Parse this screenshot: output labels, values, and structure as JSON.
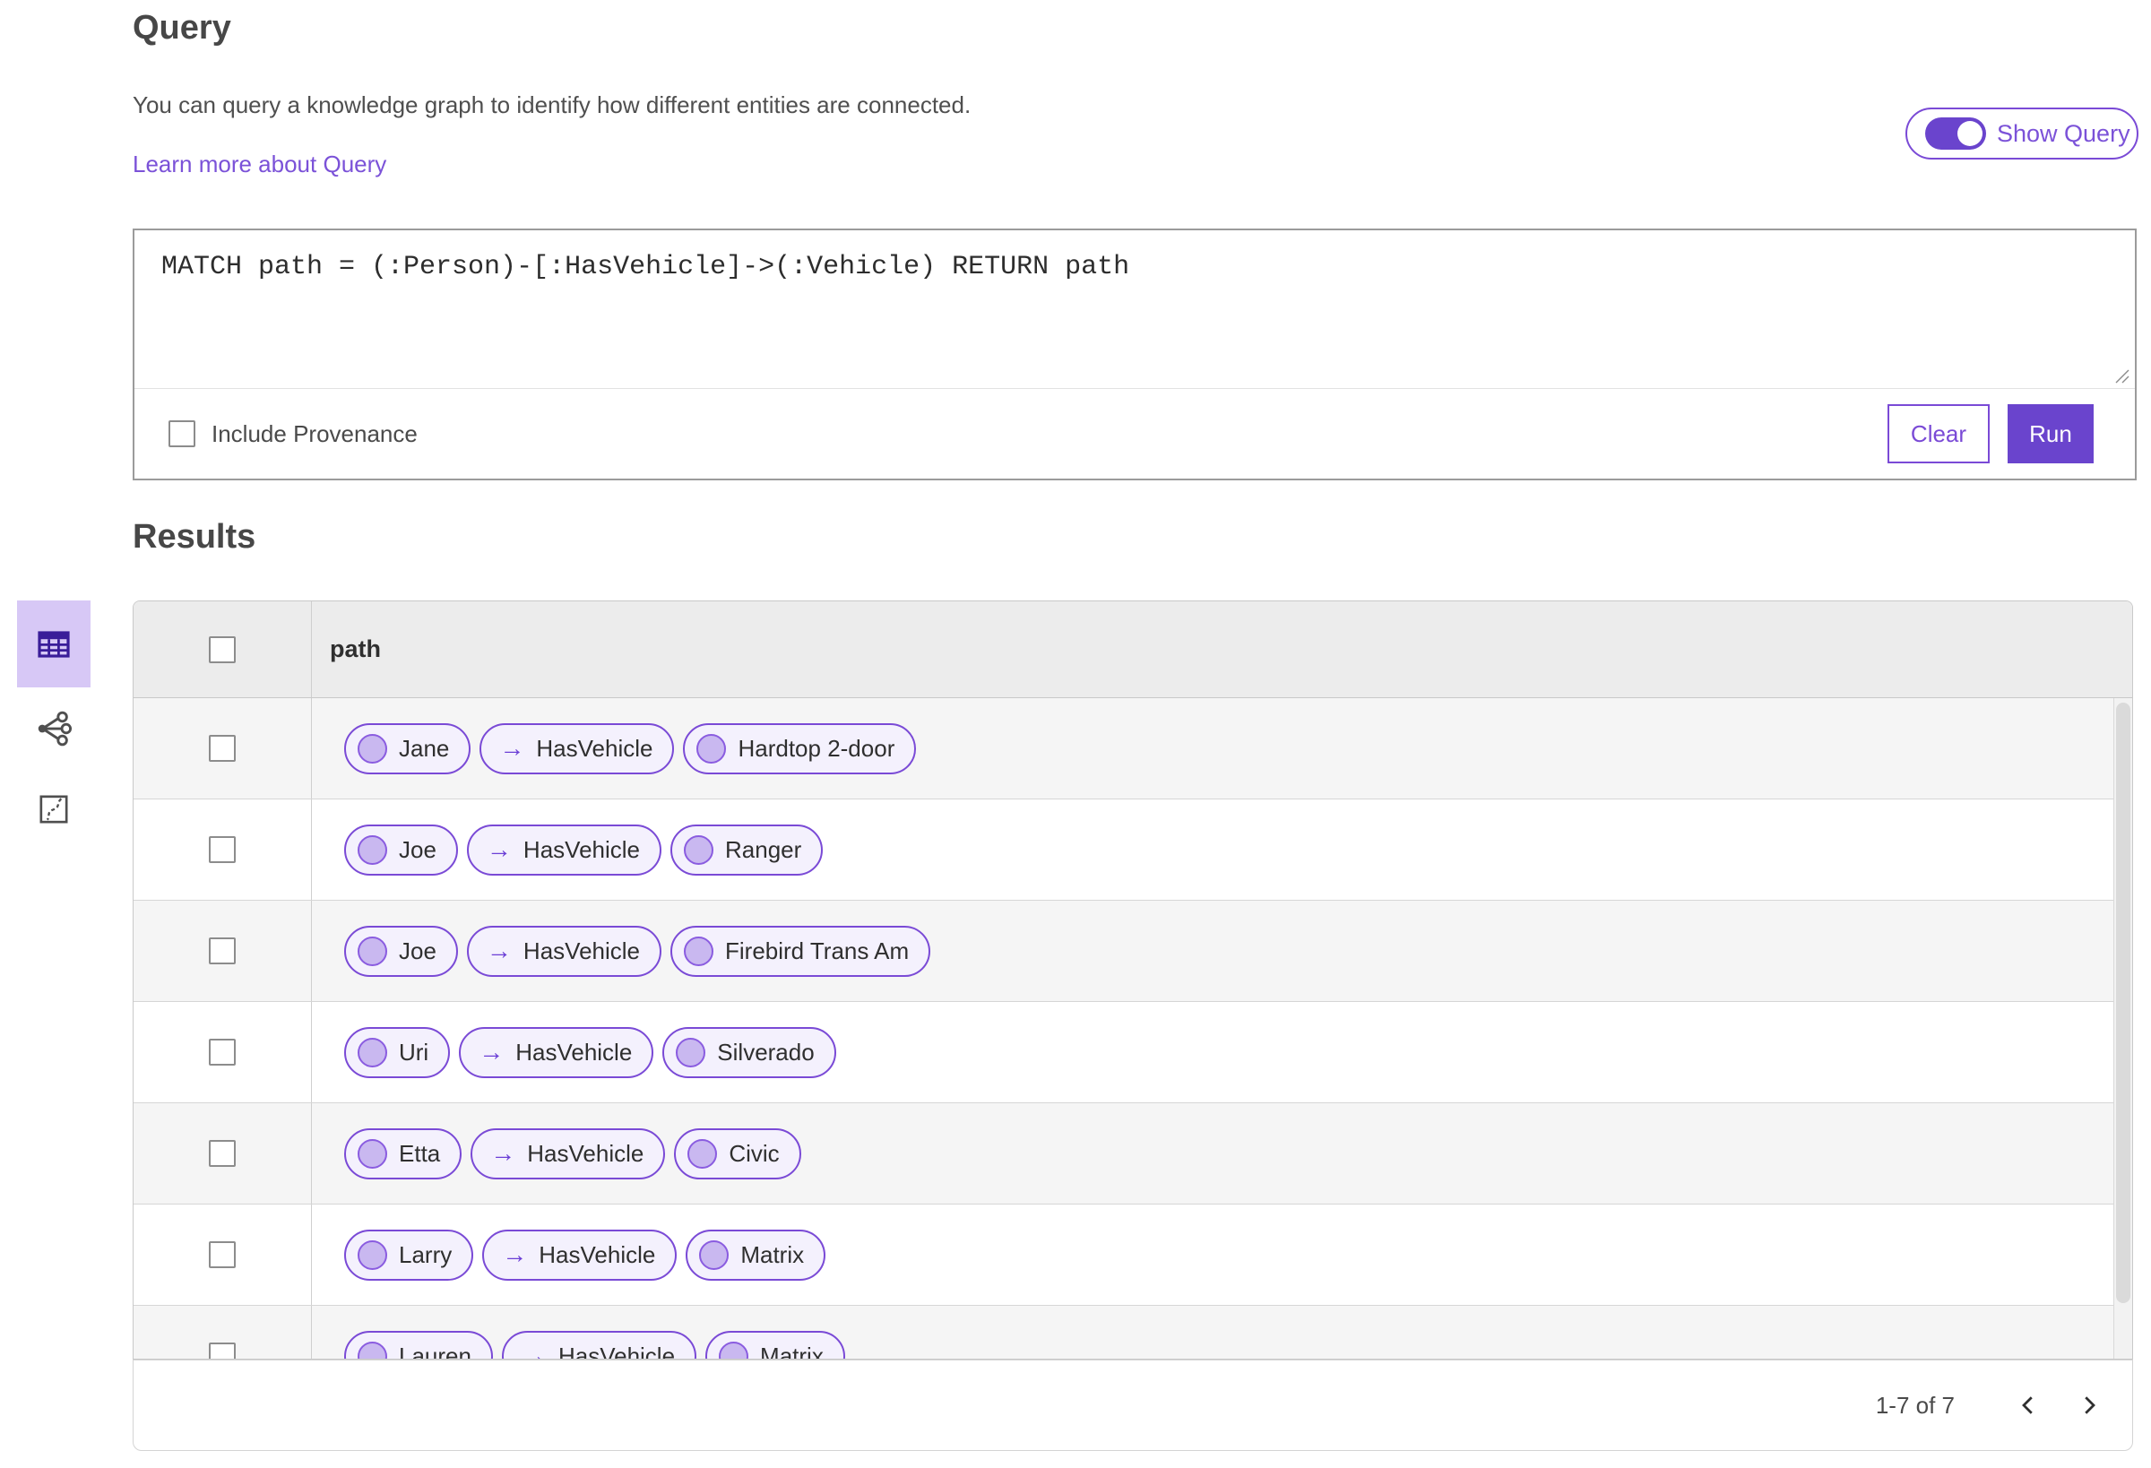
{
  "header": {
    "title": "Query",
    "description": "You can query a knowledge graph to identify how different entities are connected.",
    "learn_more_label": "Learn more about Query",
    "show_query_label": "Show Query",
    "show_query_on": true
  },
  "query_panel": {
    "query_text": "MATCH path = (:Person)-[:HasVehicle]->(:Vehicle) RETURN path",
    "include_provenance_label": "Include Provenance",
    "include_provenance_checked": false,
    "clear_label": "Clear",
    "run_label": "Run"
  },
  "results": {
    "title": "Results",
    "column_header": "path",
    "views": [
      "table-view",
      "link-chart-view",
      "map-view"
    ],
    "selected_view": "table-view",
    "rows": [
      {
        "person": "Jane",
        "relationship": "HasVehicle",
        "vehicle": "Hardtop 2-door"
      },
      {
        "person": "Joe",
        "relationship": "HasVehicle",
        "vehicle": "Ranger"
      },
      {
        "person": "Joe",
        "relationship": "HasVehicle",
        "vehicle": "Firebird Trans Am"
      },
      {
        "person": "Uri",
        "relationship": "HasVehicle",
        "vehicle": "Silverado"
      },
      {
        "person": "Etta",
        "relationship": "HasVehicle",
        "vehicle": "Civic"
      },
      {
        "person": "Larry",
        "relationship": "HasVehicle",
        "vehicle": "Matrix"
      },
      {
        "person": "Lauren",
        "relationship": "HasVehicle",
        "vehicle": "Matrix"
      }
    ],
    "pagination": {
      "range_label": "1-7 of 7"
    }
  },
  "icons": {
    "relationship_arrow": "→"
  },
  "colors": {
    "accent_purple": "#6a44cd",
    "pill_border": "#7a4ad6",
    "pill_background": "#f4f1fd",
    "node_circle_fill": "#c9b8f0",
    "selected_view_background": "#d7c8f6",
    "link_purple": "#7b52d8"
  }
}
